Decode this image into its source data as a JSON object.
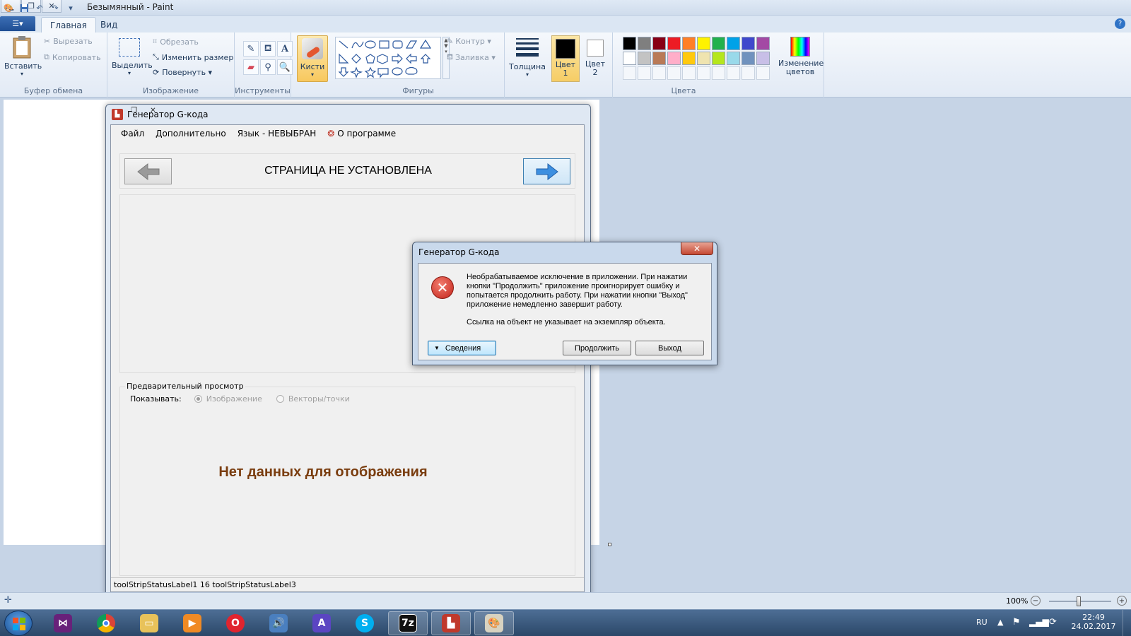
{
  "window": {
    "title": "Безымянный - Paint"
  },
  "qat": {
    "save": "save-icon",
    "undo": "undo-icon",
    "redo": "redo-icon",
    "customize": "▾"
  },
  "tabs": {
    "file": "▾",
    "home": "Главная",
    "view": "Вид"
  },
  "ribbon": {
    "clipboard": {
      "paste": "Вставить",
      "cut": "Вырезать",
      "copy": "Копировать",
      "label": "Буфер обмена"
    },
    "image": {
      "select": "Выделить",
      "crop": "Обрезать",
      "resize": "Изменить размер",
      "rotate": "Повернуть ▾",
      "label": "Изображение"
    },
    "tools": {
      "label": "Инструменты"
    },
    "brushes": {
      "label": "Кисти"
    },
    "shapes": {
      "outline": "Контур ▾",
      "fill": "Заливка ▾",
      "label": "Фигуры"
    },
    "size": {
      "label": "Толщина"
    },
    "color1": {
      "label": "Цвет 1"
    },
    "color2": {
      "label": "Цвет 2"
    },
    "colors": {
      "label": "Цвета",
      "edit": "Изменение цветов",
      "row1": [
        "#000000",
        "#7f7f7f",
        "#880015",
        "#ed1c24",
        "#ff7f27",
        "#fff200",
        "#22b14c",
        "#00a2e8",
        "#3f48cc",
        "#a349a4"
      ],
      "row2": [
        "#ffffff",
        "#c3c3c3",
        "#b97a57",
        "#ffaec9",
        "#ffc90e",
        "#efe4b0",
        "#b5e61d",
        "#99d9ea",
        "#7092be",
        "#c8bfe7"
      ]
    }
  },
  "app": {
    "title": "Генератор G-кода",
    "menu": [
      "Файл",
      "Дополнительно",
      "Язык - НЕВЫБРАН",
      "О программе"
    ],
    "page_title": "СТРАНИЦА НЕ УСТАНОВЛЕНА",
    "preview": {
      "label": "Предварительный просмотр",
      "show": "Показывать:",
      "opt1": "Изображение",
      "opt2": "Векторы/точки",
      "nodata": "Нет данных для отображения"
    },
    "status": "toolStripStatusLabel1  16  toolStripStatusLabel3"
  },
  "dialog": {
    "title": "Генератор G-кода",
    "message_lines": [
      "Необрабатываемое исключение в приложении. При нажатии",
      "кнопки \"Продолжить\" приложение проигнорирует ошибку и",
      "попытается продолжить работу. При нажатии кнопки \"Выход\"",
      "приложение немедленно завершит работу."
    ],
    "message2": "Ссылка на объект не указывает на экземпляр объекта.",
    "details": "Сведения",
    "continue": "Продолжить",
    "exit": "Выход"
  },
  "paint_status": {
    "zoom": "100%"
  },
  "taskbar": {
    "lang": "RU",
    "time": "22:49",
    "date": "24.02.2017"
  }
}
